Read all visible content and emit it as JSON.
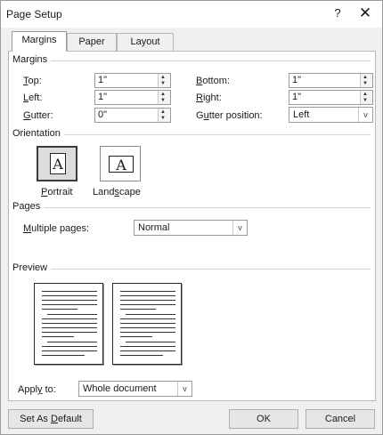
{
  "window": {
    "title": "Page Setup",
    "help": "?",
    "close": "✕"
  },
  "tabs": [
    {
      "label": "Margins",
      "active": true
    },
    {
      "label": "Paper",
      "active": false
    },
    {
      "label": "Layout",
      "active": false
    }
  ],
  "margins": {
    "group_label": "Margins",
    "top": {
      "label_mn": "T",
      "label_rest": "op:",
      "value": "1\""
    },
    "bottom": {
      "label_mn": "B",
      "label_rest": "ottom:",
      "value": "1\""
    },
    "left": {
      "label_mn": "L",
      "label_rest": "eft:",
      "value": "1\""
    },
    "right": {
      "label_mn": "R",
      "label_rest": "ight:",
      "value": "1\""
    },
    "gutter": {
      "label_mn": "G",
      "label_rest": "utter:",
      "value": "0\""
    },
    "gutter_position": {
      "label_pre": "G",
      "label_mn": "u",
      "label_rest": "tter position:",
      "value": "Left"
    }
  },
  "orientation": {
    "group_label": "Orientation",
    "portrait": {
      "label_mn": "P",
      "label_rest": "ortrait",
      "icon_glyph": "A"
    },
    "landscape": {
      "label_pre": "Land",
      "label_mn": "s",
      "label_rest": "cape",
      "icon_glyph": "A"
    }
  },
  "pages": {
    "group_label": "Pages",
    "multiple_pages": {
      "label_mn": "M",
      "label_rest": "ultiple pages:",
      "value": "Normal"
    }
  },
  "preview": {
    "group_label": "Preview"
  },
  "apply_to": {
    "label_pre": "Appl",
    "label_mn": "y",
    "label_rest": " to:",
    "value": "Whole document"
  },
  "buttons": {
    "set_default_pre": "Set As ",
    "set_default_mn": "D",
    "set_default_rest": "efault",
    "ok": "OK",
    "cancel": "Cancel"
  },
  "icons": {
    "spin_up": "▲",
    "spin_down": "▼",
    "dropdown": "v"
  }
}
